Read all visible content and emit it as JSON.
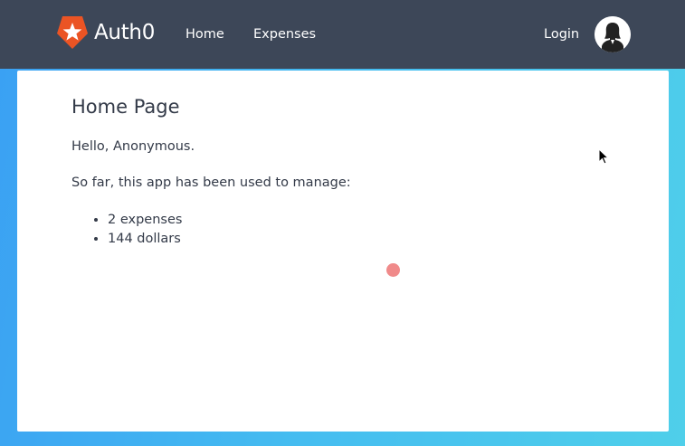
{
  "navbar": {
    "brand": "Auth0",
    "links": {
      "home": "Home",
      "expenses": "Expenses"
    },
    "login": "Login",
    "avatar_icon": "user-silhouette-icon"
  },
  "main": {
    "title": "Home Page",
    "greeting": "Hello, Anonymous.",
    "intro": "So far, this app has been used to manage:",
    "stats": [
      "2 expenses",
      "144 dollars"
    ]
  },
  "colors": {
    "navbar_bg": "#3d4758",
    "brand_accent": "#eb5424",
    "text": "#333a48",
    "background_gradient_start": "#3aa0f3",
    "background_gradient_end": "#4fcfea"
  }
}
